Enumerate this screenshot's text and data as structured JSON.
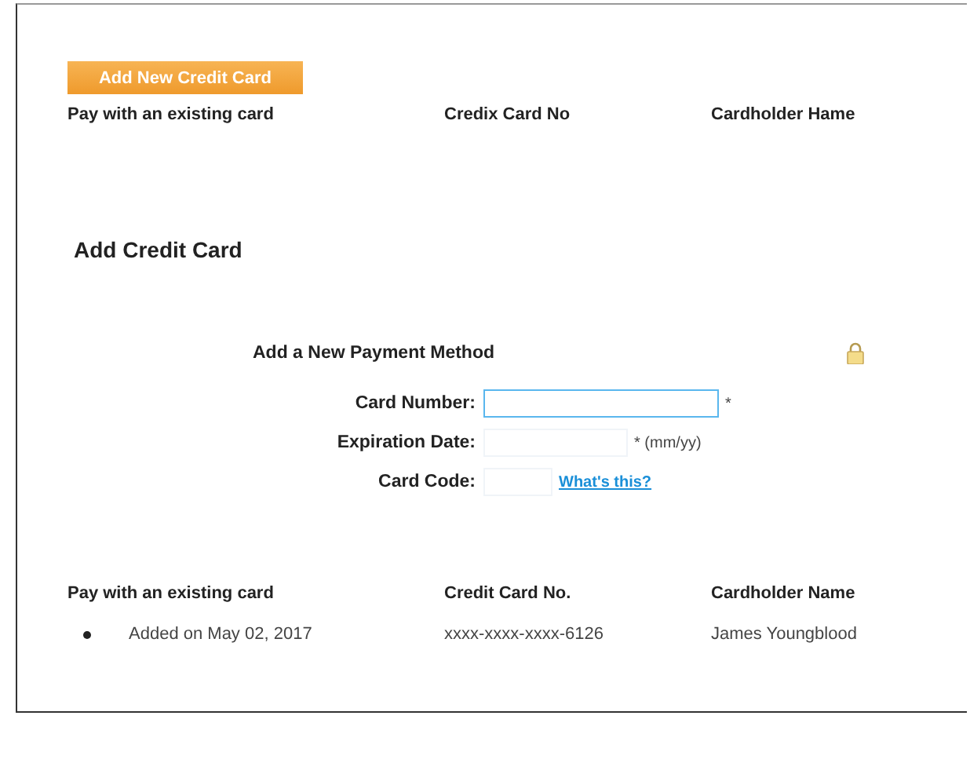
{
  "add_button": {
    "label": "Add New Credit Card"
  },
  "top_table": {
    "columns": [
      "Pay with an existing card",
      "Credix Card No",
      "Cardholder Hame"
    ]
  },
  "section_title": "Add Credit Card",
  "form": {
    "heading": "Add a New Payment Method",
    "fields": [
      {
        "kind": "text",
        "label": "Card Number:",
        "focused": true,
        "after": "*"
      },
      {
        "kind": "text",
        "label": "Expiration Date:",
        "focused": false,
        "after": "* (mm/yy)"
      },
      {
        "kind": "link",
        "label": "Card Code:",
        "focused": false,
        "after": "What's this?"
      }
    ]
  },
  "bottom_table": {
    "columns": [
      "Pay with an existing card",
      "Credit Card No.",
      "Cardholder Name"
    ],
    "rows": [
      {
        "cells": [
          "Added on May 02, 2017",
          "xxxx-xxxx-xxxx-6126",
          "James Youngblood"
        ]
      }
    ]
  }
}
